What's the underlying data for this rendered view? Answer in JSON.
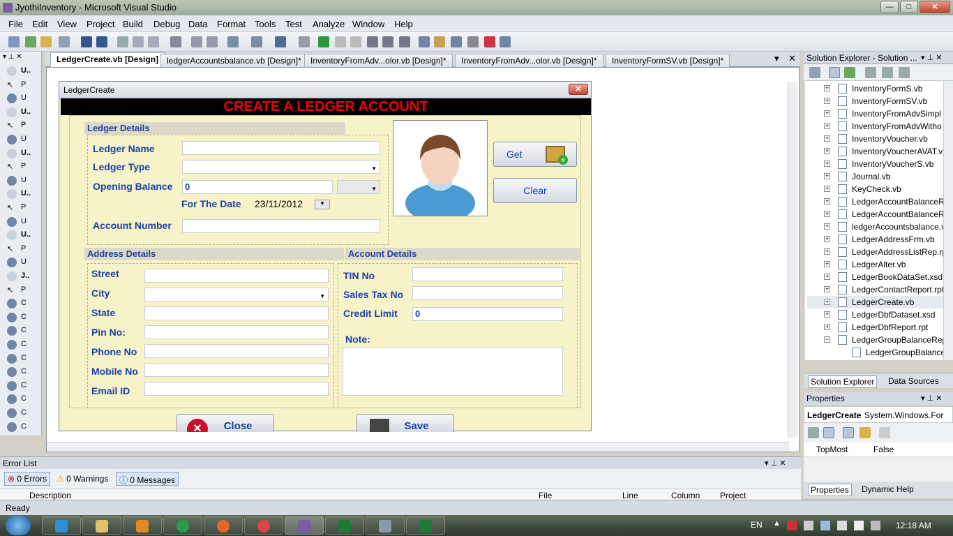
{
  "window": {
    "title": "JyothiInventory - Microsoft Visual Studio",
    "min": "—",
    "max": "□",
    "close": "✕"
  },
  "menu": [
    "File",
    "Edit",
    "View",
    "Project",
    "Build",
    "Debug",
    "Data",
    "Format",
    "Tools",
    "Test",
    "Analyze",
    "Window",
    "Help"
  ],
  "toolbox": {
    "items": [
      "U..",
      "P",
      "U",
      "U..",
      "P",
      "U",
      "U..",
      "P",
      "U",
      "U..",
      "P",
      "U",
      "U..",
      "P",
      "U",
      "J..",
      "P",
      "C",
      "C",
      "C",
      "C",
      "C",
      "C",
      "C",
      "C",
      "C",
      "C"
    ]
  },
  "doc_tabs": [
    "LedgerCreate.vb [Design]",
    "ledgerAccountsbalance.vb [Design]*",
    "InventoryFromAdv...olor.vb [Design]*",
    "InventoryFromAdv...olor.vb [Design]*",
    "InventoryFormSV.vb [Design]*"
  ],
  "form": {
    "title": "LedgerCreate",
    "close": "✕",
    "banner": "CREATE A LEDGER ACCOUNT",
    "ledger_details": {
      "header": "Ledger Details",
      "ledger_name_label": "Ledger Name",
      "ledger_type_label": "Ledger Type",
      "opening_balance_label": "Opening Balance",
      "opening_balance_value": "0",
      "for_the_date_label": "For The Date",
      "date_value": "23/11/2012",
      "account_number_label": "Account Number"
    },
    "buttons": {
      "get": "Get",
      "clear": "Clear",
      "close": "Close",
      "save": "Save"
    },
    "address_details": {
      "header": "Address Details",
      "street": "Street",
      "city": "City",
      "state": "State",
      "pin": "Pin No:",
      "phone": "Phone No",
      "mobile": "Mobile No",
      "email": "Email ID"
    },
    "account_details": {
      "header": "Account Details",
      "tin": "TIN No",
      "sales_tax": "Sales Tax No",
      "credit_limit": "Credit Limit",
      "credit_limit_value": "0",
      "note": "Note:"
    }
  },
  "solution_explorer": {
    "title": "Solution Explorer - Solution ...",
    "items": [
      "InventoryFormS.vb",
      "InventoryFormSV.vb",
      "InventoryFromAdvSimpl",
      "InventoryFromAdvWitho",
      "InventoryVoucher.vb",
      "InventoryVoucherAVAT.v",
      "InventoryVoucherS.vb",
      "Journal.vb",
      "KeyCheck.vb",
      "LedgerAccountBalanceR",
      "LedgerAccountBalanceR",
      "ledgerAccountsbalance.v",
      "LedgerAddressFrm.vb",
      "LedgerAddressListRep.rp",
      "LedgerAlter.vb",
      "LedgerBookDataSet.xsd",
      "LedgerContactReport.rpt",
      "LedgerCreate.vb",
      "LedgerDbfDataset.xsd",
      "LedgerDbfReport.rpt",
      "LedgerGroupBalanceRep",
      "LedgerGroupBalance"
    ],
    "tabs": [
      "Solution Explorer",
      "Data Sources"
    ]
  },
  "properties": {
    "title": "Properties",
    "object": "LedgerCreate",
    "object_type": "System.Windows.For",
    "row_name": "TopMost",
    "row_value": "False",
    "tabs": [
      "Properties",
      "Dynamic Help"
    ]
  },
  "error_list": {
    "title": "Error List",
    "errors": "0 Errors",
    "warnings": "0 Warnings",
    "messages": "0 Messages",
    "columns": [
      "Description",
      "File",
      "Line",
      "Column",
      "Project"
    ]
  },
  "status": "Ready",
  "tray": {
    "lang": "EN",
    "time": "12:18 AM"
  },
  "colors": {
    "banner_text": "#ee0000",
    "form_bg": "#f7f3c9",
    "label": "#1a3fa7"
  }
}
